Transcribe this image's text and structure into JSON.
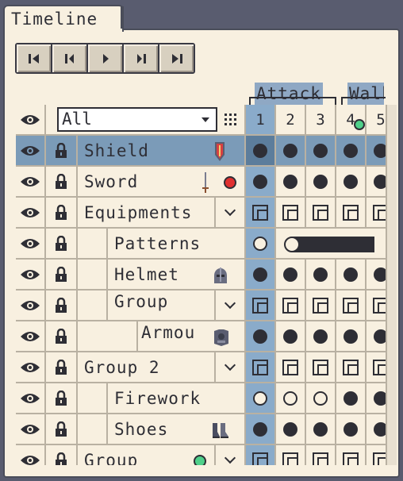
{
  "tab": {
    "title": "Timeline"
  },
  "transport": [
    {
      "name": "first-frame",
      "icon": "skip-to-start-icon"
    },
    {
      "name": "prev-frame",
      "icon": "step-back-icon"
    },
    {
      "name": "play",
      "icon": "play-icon"
    },
    {
      "name": "next-frame",
      "icon": "step-forward-icon"
    },
    {
      "name": "last-frame",
      "icon": "skip-to-end-icon"
    }
  ],
  "tags": [
    {
      "label": "Attack",
      "color": "#8fa8c4"
    },
    {
      "label": "Walk",
      "color": "#8fa8c4"
    }
  ],
  "header": {
    "filter_value": "All",
    "frames": [
      "1",
      "2",
      "3",
      "4",
      "5"
    ]
  },
  "layers": [
    {
      "name": "Shield",
      "selected": true,
      "indent": 0,
      "expandable": false,
      "thumb": "shield-thumbnail-icon"
    },
    {
      "name": "Sword",
      "selected": false,
      "indent": 0,
      "expandable": false,
      "thumb": "sword-thumbnail-icon"
    },
    {
      "name": "Equipments",
      "selected": false,
      "indent": 0,
      "expandable": true
    },
    {
      "name": "Patterns",
      "selected": false,
      "indent": 1,
      "expandable": false
    },
    {
      "name": "Helmet",
      "selected": false,
      "indent": 1,
      "expandable": false,
      "thumb": "helmet-thumbnail-icon"
    },
    {
      "name": "Group",
      "selected": false,
      "indent": 1,
      "expandable": true
    },
    {
      "name": "Armou",
      "selected": false,
      "indent": 2,
      "expandable": false,
      "thumb": "armour-thumbnail-icon"
    },
    {
      "name": "Group 2",
      "selected": false,
      "indent": 0,
      "expandable": true
    },
    {
      "name": "Firework",
      "selected": false,
      "indent": 1,
      "expandable": false
    },
    {
      "name": "Shoes",
      "selected": false,
      "indent": 1,
      "expandable": false,
      "thumb": "shoes-thumbnail-icon"
    },
    {
      "name": "Group",
      "selected": false,
      "indent": 0,
      "expandable": true
    }
  ],
  "colors": {
    "frame_column": "#8aabca",
    "selected_row": "#7b9bb8",
    "accent_green": "#4fd08a",
    "accent_red": "#e03030"
  }
}
